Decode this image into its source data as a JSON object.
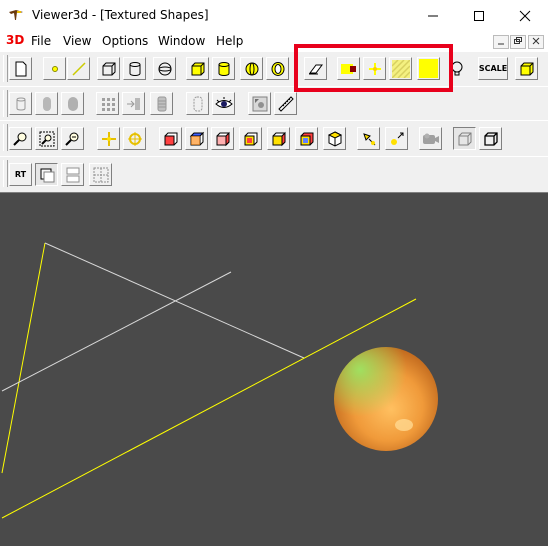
{
  "window": {
    "title": "Viewer3d - [Textured Shapes]",
    "min_icon": "minimize-icon",
    "max_icon": "maximize-icon",
    "close_icon": "close-icon"
  },
  "menubar": {
    "logo": "3D",
    "items": [
      "File",
      "View",
      "Options",
      "Window",
      "Help"
    ]
  },
  "toolbar": {
    "scale_label": "SCALE",
    "rt_label": "RT"
  },
  "colors": {
    "accent_highlight": "#e8001c",
    "viewport_bg": "#4a4a4a",
    "yellow_shape": "#ffff00"
  }
}
